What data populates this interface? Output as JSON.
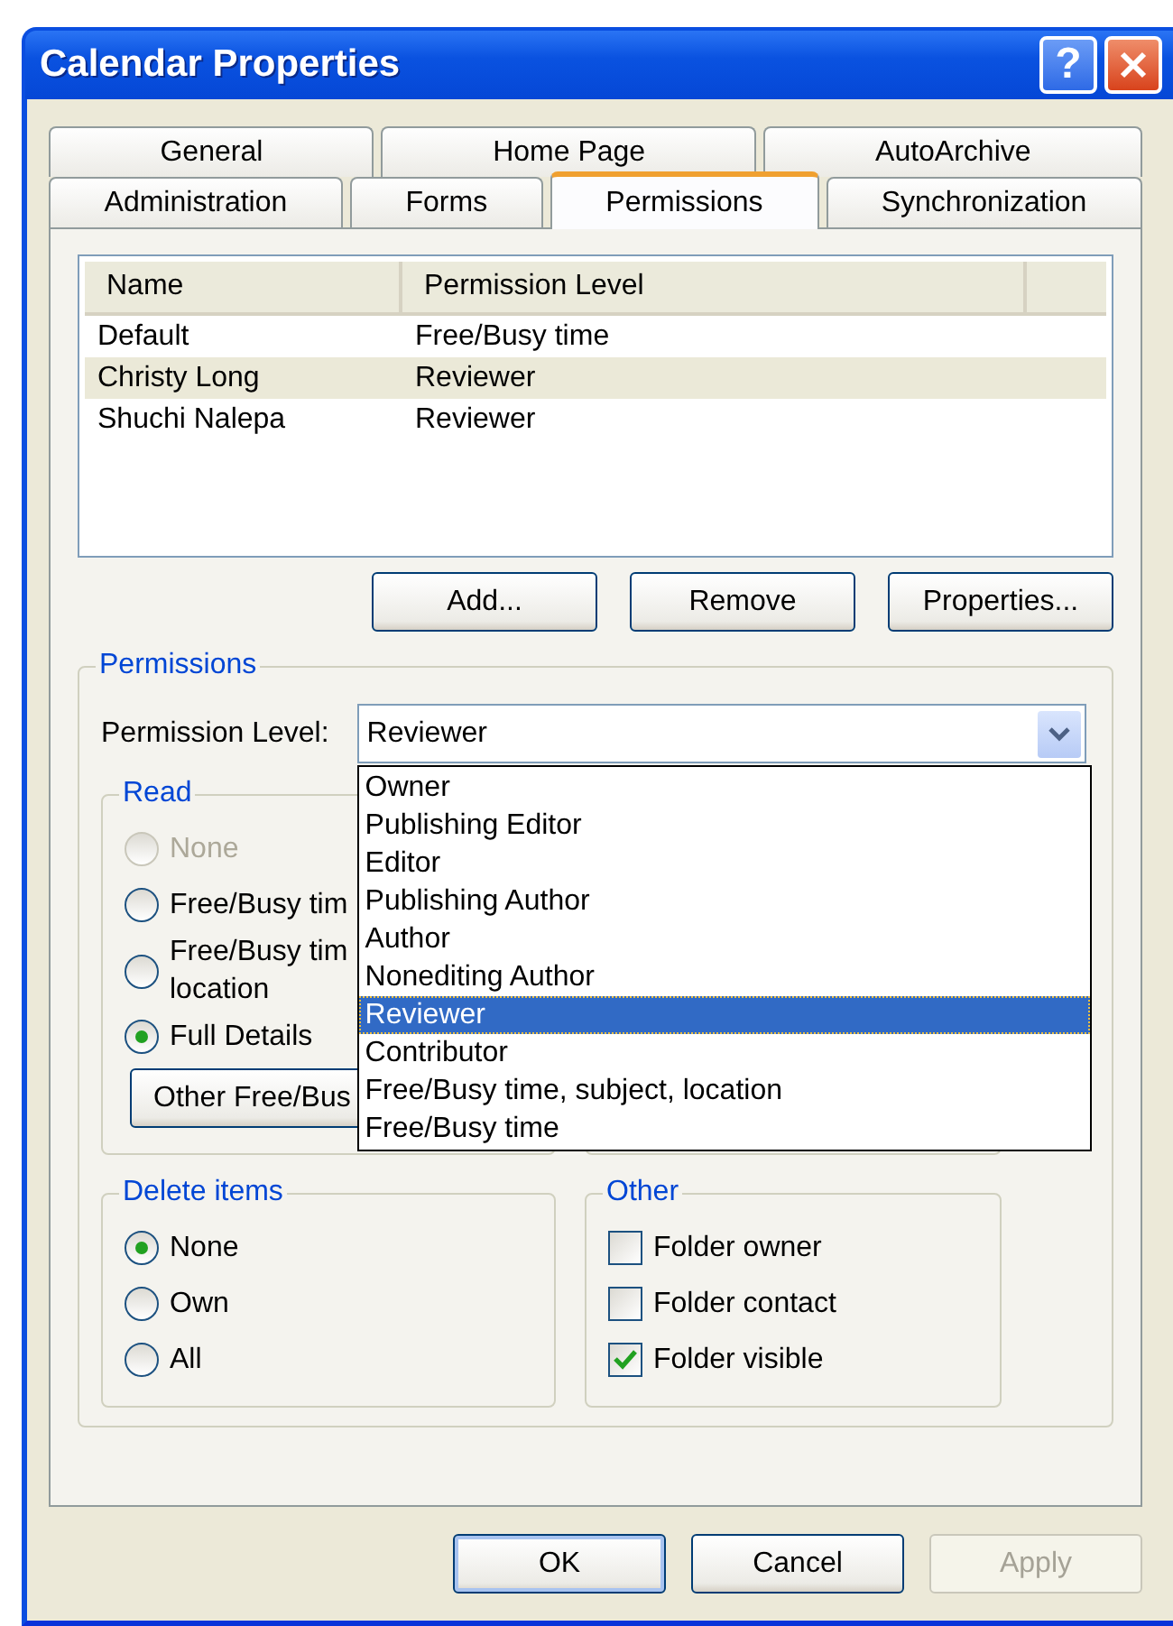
{
  "window": {
    "title": "Calendar Properties",
    "help_button": "?"
  },
  "tabs": [
    [
      {
        "label": "General",
        "selected": false
      },
      {
        "label": "Home Page",
        "selected": false
      },
      {
        "label": "AutoArchive",
        "selected": false
      }
    ],
    [
      {
        "label": "Administration",
        "selected": false
      },
      {
        "label": "Forms",
        "selected": false
      },
      {
        "label": "Permissions",
        "selected": true
      },
      {
        "label": "Synchronization",
        "selected": false
      }
    ]
  ],
  "permission_list": {
    "columns": [
      "Name",
      "Permission Level"
    ],
    "rows": [
      {
        "name": "Default",
        "permission_level": "Free/Busy time",
        "selected": false
      },
      {
        "name": "Christy Long",
        "permission_level": "Reviewer",
        "selected": true
      },
      {
        "name": "Shuchi Nalepa",
        "permission_level": "Reviewer",
        "selected": false
      }
    ]
  },
  "list_buttons": [
    "Add...",
    "Remove",
    "Properties..."
  ],
  "permissions": {
    "title": "Permissions",
    "level_label": "Permission Level:",
    "level_value": "Reviewer",
    "dropdown": [
      {
        "label": "Owner",
        "selected": false
      },
      {
        "label": "Publishing Editor",
        "selected": false
      },
      {
        "label": "Editor",
        "selected": false
      },
      {
        "label": "Publishing Author",
        "selected": false
      },
      {
        "label": "Author",
        "selected": false
      },
      {
        "label": "Nonediting Author",
        "selected": false
      },
      {
        "label": "Reviewer",
        "selected": true
      },
      {
        "label": "Contributor",
        "selected": false
      },
      {
        "label": "Free/Busy time, subject, location",
        "selected": false
      },
      {
        "label": "Free/Busy time",
        "selected": false
      }
    ]
  },
  "read": {
    "title": "Read",
    "options": [
      {
        "lines": [
          "None"
        ],
        "selected": false,
        "disabled": true
      },
      {
        "lines": [
          "Free/Busy tim"
        ],
        "selected": false,
        "disabled": false
      },
      {
        "lines": [
          "Free/Busy tim",
          "location"
        ],
        "selected": false,
        "disabled": false
      },
      {
        "lines": [
          "Full Details"
        ],
        "selected": true,
        "disabled": false
      }
    ],
    "button": "Other Free/Bus"
  },
  "delete_items": {
    "title": "Delete items",
    "options": [
      {
        "label": "None",
        "selected": true
      },
      {
        "label": "Own",
        "selected": false
      },
      {
        "label": "All",
        "selected": false
      }
    ]
  },
  "other": {
    "title": "Other",
    "options": [
      {
        "label": "Folder owner",
        "checked": false
      },
      {
        "label": "Folder contact",
        "checked": false
      },
      {
        "label": "Folder visible",
        "checked": true
      }
    ]
  },
  "buttons": [
    {
      "label": "OK",
      "disabled": false,
      "default": true
    },
    {
      "label": "Cancel",
      "disabled": false,
      "default": false
    },
    {
      "label": "Apply",
      "disabled": true,
      "default": false
    }
  ]
}
